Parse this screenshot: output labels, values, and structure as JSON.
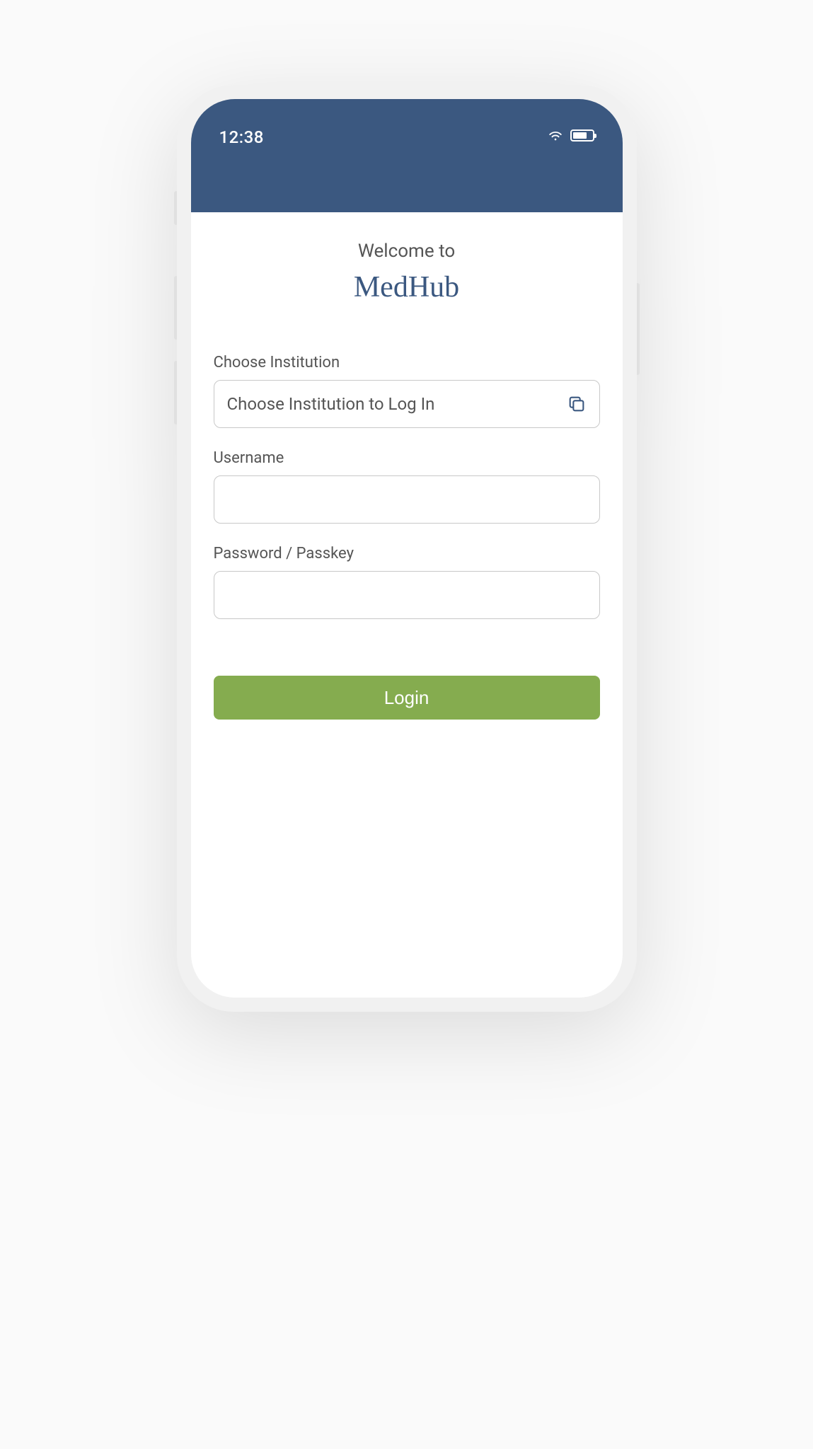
{
  "status": {
    "time": "12:38"
  },
  "header": {
    "welcome": "Welcome to",
    "brand": "MedHub"
  },
  "form": {
    "institution": {
      "label": "Choose Institution",
      "placeholder": "Choose Institution to Log In"
    },
    "username": {
      "label": "Username",
      "value": ""
    },
    "password": {
      "label": "Password / Passkey",
      "value": ""
    },
    "login_button": "Login"
  }
}
